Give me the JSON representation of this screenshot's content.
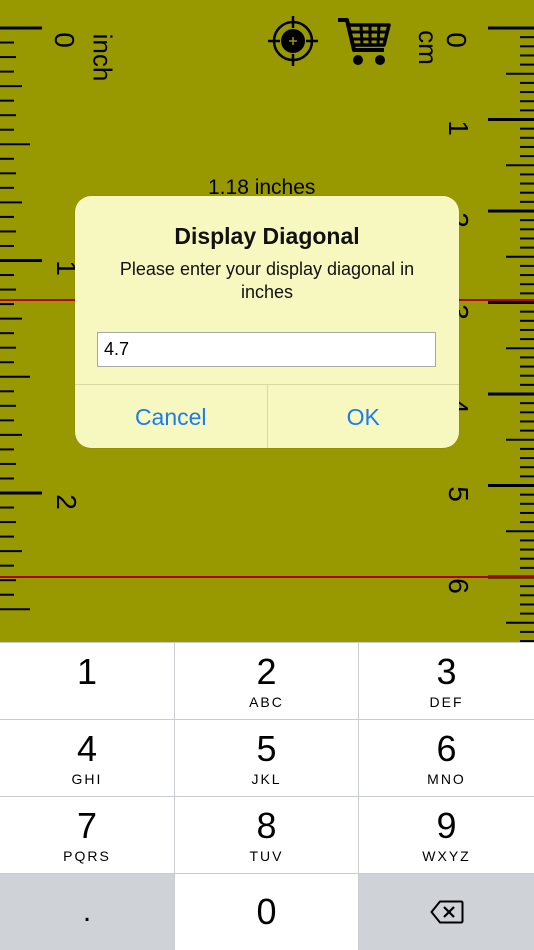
{
  "ruler": {
    "inch_unit": "inch",
    "cm_unit": "cm",
    "inch_numbers": [
      "0",
      "1",
      "2"
    ],
    "cm_numbers": [
      "0",
      "1",
      "2",
      "3",
      "4",
      "5",
      "6"
    ],
    "measurement": "1.18  inches",
    "marker_color": "#b00000",
    "background_color": "#989800"
  },
  "toolbar": {
    "target_icon": "crosshair-icon",
    "cart_icon": "cart-icon"
  },
  "dialog": {
    "title": "Display Diagonal",
    "message": "Please enter your display diagonal in inches",
    "input_value": "4.7",
    "cancel_label": "Cancel",
    "ok_label": "OK",
    "accent_color": "#1a7cf5"
  },
  "keypad": {
    "keys": [
      {
        "num": "1",
        "sub": ""
      },
      {
        "num": "2",
        "sub": "ABC"
      },
      {
        "num": "3",
        "sub": "DEF"
      },
      {
        "num": "4",
        "sub": "GHI"
      },
      {
        "num": "5",
        "sub": "JKL"
      },
      {
        "num": "6",
        "sub": "MNO"
      },
      {
        "num": "7",
        "sub": "PQRS"
      },
      {
        "num": "8",
        "sub": "TUV"
      },
      {
        "num": "9",
        "sub": "WXYZ"
      },
      {
        "num": ".",
        "sub": ""
      },
      {
        "num": "0",
        "sub": ""
      }
    ],
    "backspace_icon": "backspace-icon"
  }
}
